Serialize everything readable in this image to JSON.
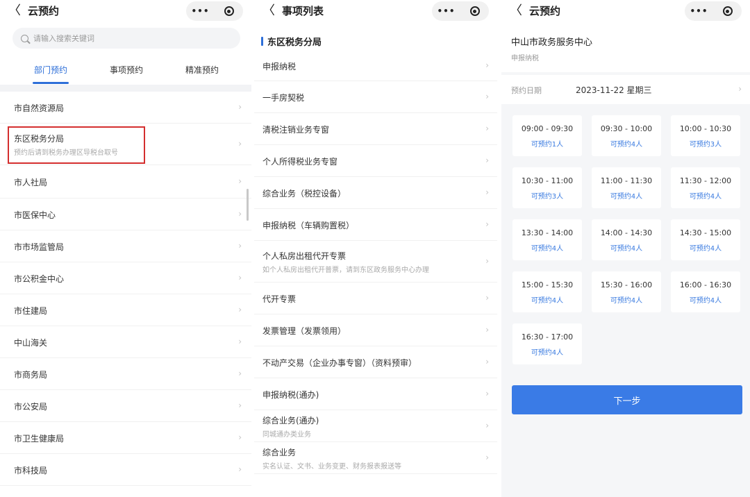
{
  "panel1": {
    "nav": {
      "back": "〈",
      "title": "云预约",
      "more": "•••"
    },
    "search": {
      "placeholder": "请输入搜索关键词"
    },
    "tabs": [
      "部门预约",
      "事项预约",
      "精准预约"
    ],
    "active_tab": 0,
    "items": [
      {
        "title": "市自然资源局",
        "sub": ""
      },
      {
        "title": "东区税务分局",
        "sub": "预约后请到税务办理区导税台取号"
      },
      {
        "title": "市人社局",
        "sub": ""
      },
      {
        "title": "市医保中心",
        "sub": ""
      },
      {
        "title": "市市场监管局",
        "sub": ""
      },
      {
        "title": "市公积金中心",
        "sub": ""
      },
      {
        "title": "市住建局",
        "sub": ""
      },
      {
        "title": "中山海关",
        "sub": ""
      },
      {
        "title": "市商务局",
        "sub": ""
      },
      {
        "title": "市公安局",
        "sub": ""
      },
      {
        "title": "市卫生健康局",
        "sub": ""
      },
      {
        "title": "市科技局",
        "sub": ""
      }
    ]
  },
  "panel2": {
    "nav": {
      "back": "〈",
      "title": "事项列表",
      "more": "•••"
    },
    "section_title": "东区税务分局",
    "items": [
      {
        "title": "申报纳税",
        "sub": ""
      },
      {
        "title": "一手房契税",
        "sub": ""
      },
      {
        "title": "清税注销业务专窗",
        "sub": ""
      },
      {
        "title": "个人所得税业务专窗",
        "sub": ""
      },
      {
        "title": "综合业务（税控设备）",
        "sub": ""
      },
      {
        "title": "申报纳税（车辆购置税）",
        "sub": ""
      },
      {
        "title": "个人私房出租代开专票",
        "sub": "如个人私房出租代开普票，请到东区政务服务中心办理"
      },
      {
        "title": "代开专票",
        "sub": ""
      },
      {
        "title": "发票管理（发票领用）",
        "sub": ""
      },
      {
        "title": "不动产交易（企业办事专窗）（资料预审）",
        "sub": ""
      },
      {
        "title": "申报纳税(通办)",
        "sub": ""
      },
      {
        "title": "综合业务(通办)",
        "sub": "同城通办类业务"
      },
      {
        "title": "综合业务",
        "sub": "实名认证、文书、业务变更、财务报表报送等"
      }
    ]
  },
  "panel3": {
    "nav": {
      "back": "〈",
      "title": "云预约",
      "more": "•••"
    },
    "center_name": "中山市政务服务中心",
    "service_name": "申报纳税",
    "date_label": "预约日期",
    "date_value": "2023-11-22 星期三",
    "slots": [
      {
        "time": "09:00 - 09:30",
        "avail": "可预约1人"
      },
      {
        "time": "09:30 - 10:00",
        "avail": "可预约4人"
      },
      {
        "time": "10:00 - 10:30",
        "avail": "可预约3人"
      },
      {
        "time": "10:30 - 11:00",
        "avail": "可预约3人"
      },
      {
        "time": "11:00 - 11:30",
        "avail": "可预约4人"
      },
      {
        "time": "11:30 - 12:00",
        "avail": "可预约4人"
      },
      {
        "time": "13:30 - 14:00",
        "avail": "可预约4人"
      },
      {
        "time": "14:00 - 14:30",
        "avail": "可预约4人"
      },
      {
        "time": "14:30 - 15:00",
        "avail": "可预约4人"
      },
      {
        "time": "15:00 - 15:30",
        "avail": "可预约4人"
      },
      {
        "time": "15:30 - 16:00",
        "avail": "可预约4人"
      },
      {
        "time": "16:00 - 16:30",
        "avail": "可预约4人"
      },
      {
        "time": "16:30 - 17:00",
        "avail": "可预约4人"
      }
    ],
    "next_label": "下一步"
  },
  "chevron": "›",
  "colors": {
    "accent": "#2e6fd8",
    "highlight": "#d42e2e",
    "button": "#3a7be6"
  }
}
